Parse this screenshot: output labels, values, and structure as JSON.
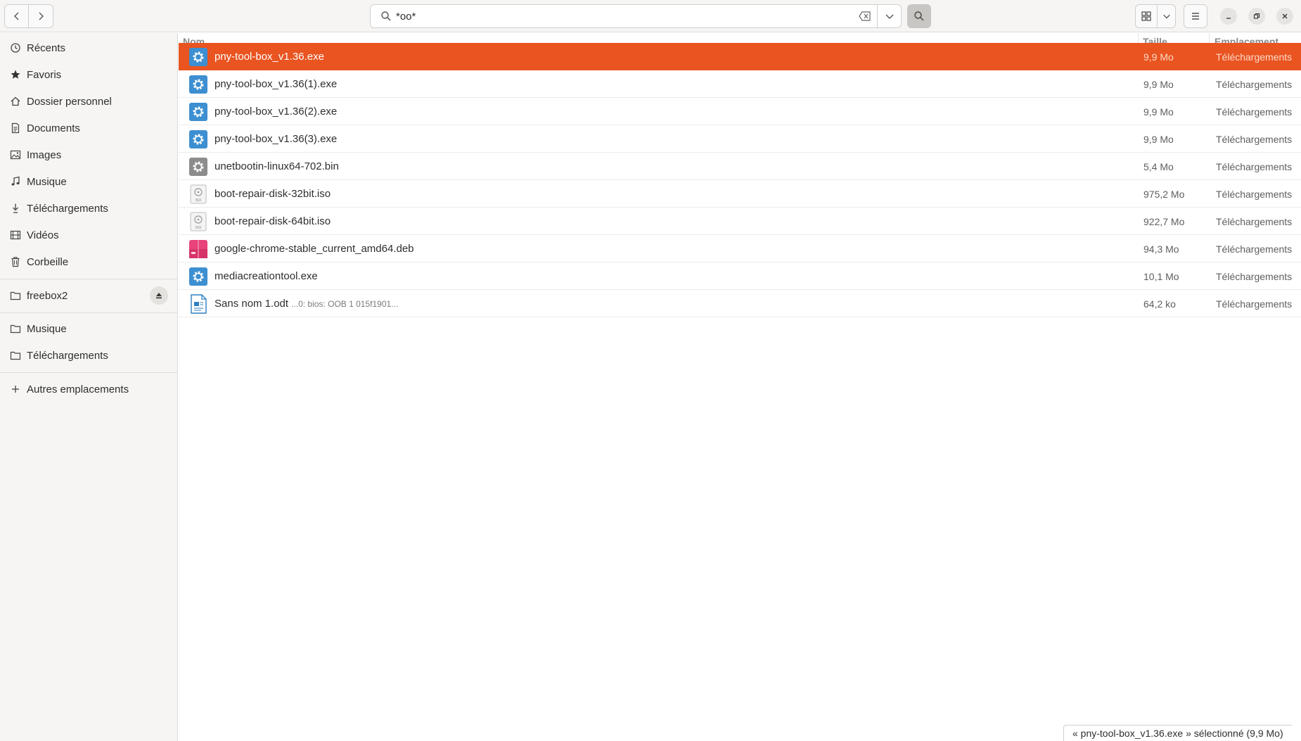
{
  "window": {
    "search": {
      "value": "*oo*"
    }
  },
  "sidebar": {
    "items": [
      {
        "label": "Récents",
        "icon": "clock-icon"
      },
      {
        "label": "Favoris",
        "icon": "star-icon"
      },
      {
        "label": "Dossier personnel",
        "icon": "home-icon"
      },
      {
        "label": "Documents",
        "icon": "document-icon"
      },
      {
        "label": "Images",
        "icon": "image-icon"
      },
      {
        "label": "Musique",
        "icon": "music-icon"
      },
      {
        "label": "Téléchargements",
        "icon": "download-icon"
      },
      {
        "label": "Vidéos",
        "icon": "video-icon"
      },
      {
        "label": "Corbeille",
        "icon": "trash-icon"
      }
    ],
    "network": [
      {
        "label": "freebox2",
        "icon": "folder-icon"
      }
    ],
    "bookmarks": [
      {
        "label": "Musique",
        "icon": "folder-icon"
      },
      {
        "label": "Téléchargements",
        "icon": "folder-icon"
      }
    ],
    "other": {
      "label": "Autres emplacements",
      "icon": "plus-icon"
    }
  },
  "columns": {
    "name": "Nom",
    "size": "Taille",
    "location": "Emplacement"
  },
  "files": [
    {
      "name": "pny-tool-box_v1.36.exe",
      "snippet": "",
      "size": "9,9 Mo",
      "location": "Téléchargements",
      "icon": "exe-gear-icon",
      "selected": true
    },
    {
      "name": "pny-tool-box_v1.36(1).exe",
      "snippet": "",
      "size": "9,9 Mo",
      "location": "Téléchargements",
      "icon": "exe-gear-icon",
      "selected": false
    },
    {
      "name": "pny-tool-box_v1.36(2).exe",
      "snippet": "",
      "size": "9,9 Mo",
      "location": "Téléchargements",
      "icon": "exe-gear-icon",
      "selected": false
    },
    {
      "name": "pny-tool-box_v1.36(3).exe",
      "snippet": "",
      "size": "9,9 Mo",
      "location": "Téléchargements",
      "icon": "exe-gear-icon",
      "selected": false
    },
    {
      "name": "unetbootin-linux64-702.bin",
      "snippet": "",
      "size": "5,4 Mo",
      "location": "Téléchargements",
      "icon": "binary-gear-icon",
      "selected": false
    },
    {
      "name": "boot-repair-disk-32bit.iso",
      "snippet": "",
      "size": "975,2 Mo",
      "location": "Téléchargements",
      "icon": "iso-disc-icon",
      "selected": false
    },
    {
      "name": "boot-repair-disk-64bit.iso",
      "snippet": "",
      "size": "922,7 Mo",
      "location": "Téléchargements",
      "icon": "iso-disc-icon",
      "selected": false
    },
    {
      "name": "google-chrome-stable_current_amd64.deb",
      "snippet": "",
      "size": "94,3 Mo",
      "location": "Téléchargements",
      "icon": "deb-package-icon",
      "selected": false
    },
    {
      "name": "mediacreationtool.exe",
      "snippet": "",
      "size": "10,1 Mo",
      "location": "Téléchargements",
      "icon": "exe-gear-icon",
      "selected": false
    },
    {
      "name": "Sans nom 1.odt",
      "snippet": "...0: bios: OOB 1 015f1901...",
      "size": "64,2 ko",
      "location": "Téléchargements",
      "icon": "odt-document-icon",
      "selected": false
    }
  ],
  "status": {
    "text": "« pny-tool-box_v1.36.exe » sélectionné  (9,9 Mo)"
  },
  "colors": {
    "accent": "#e95420",
    "exe_blue": "#3d8fd1",
    "deb_pink": "#e8437a"
  }
}
